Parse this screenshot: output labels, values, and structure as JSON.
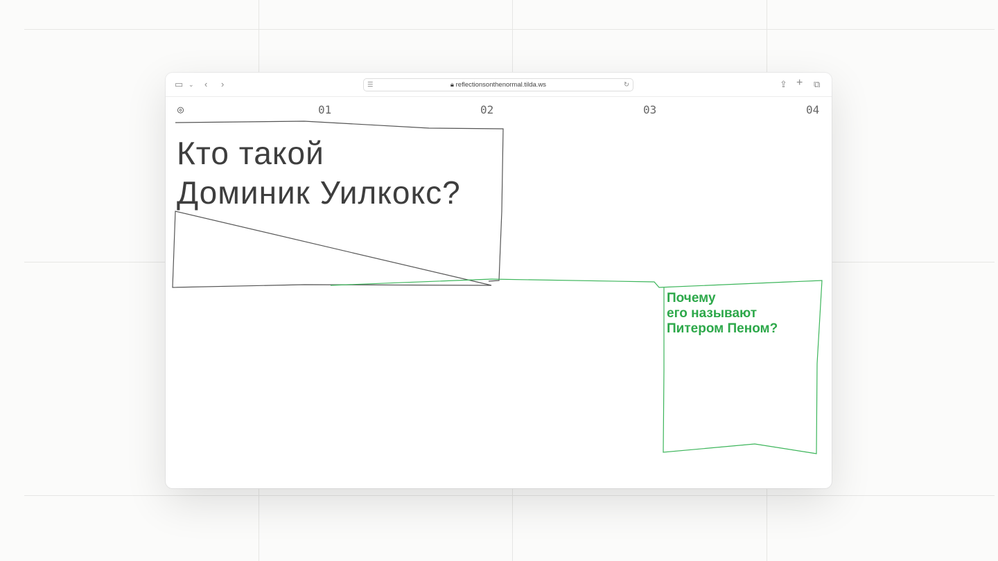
{
  "browser": {
    "url": "reflectionsonthenormal.tilda.ws"
  },
  "nav": {
    "items": [
      "01",
      "02",
      "03",
      "04"
    ]
  },
  "main": {
    "title_line1": "Кто такой",
    "title_line2": "Доминик Уилкокс?",
    "question_line1": "Почему",
    "question_line2": "его называют",
    "question_line3": "Питером Пеном?"
  },
  "colors": {
    "accent": "#2da84a",
    "text": "#3e3e3e"
  }
}
